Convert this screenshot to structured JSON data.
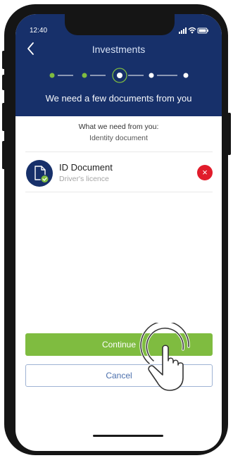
{
  "status": {
    "time": "12:40"
  },
  "header": {
    "title": "Investments",
    "subtitle": "We need a few documents from you"
  },
  "progress": {
    "total_steps": 5,
    "current_step": 3
  },
  "requirements": {
    "label": "What we need from you:",
    "value": "Identity document"
  },
  "document": {
    "title": "ID Document",
    "subtitle": "Driver's licence",
    "remove_symbol": "×"
  },
  "actions": {
    "continue_label": "Continue",
    "cancel_label": "Cancel"
  },
  "colors": {
    "header": "#17306a",
    "accent": "#7fbc40",
    "danger": "#e11c2b",
    "link": "#4c70ad"
  },
  "icons": {
    "back": "chevron-left-icon",
    "doc": "document-check-icon",
    "remove": "close-icon",
    "gesture": "tap-gesture-icon"
  }
}
